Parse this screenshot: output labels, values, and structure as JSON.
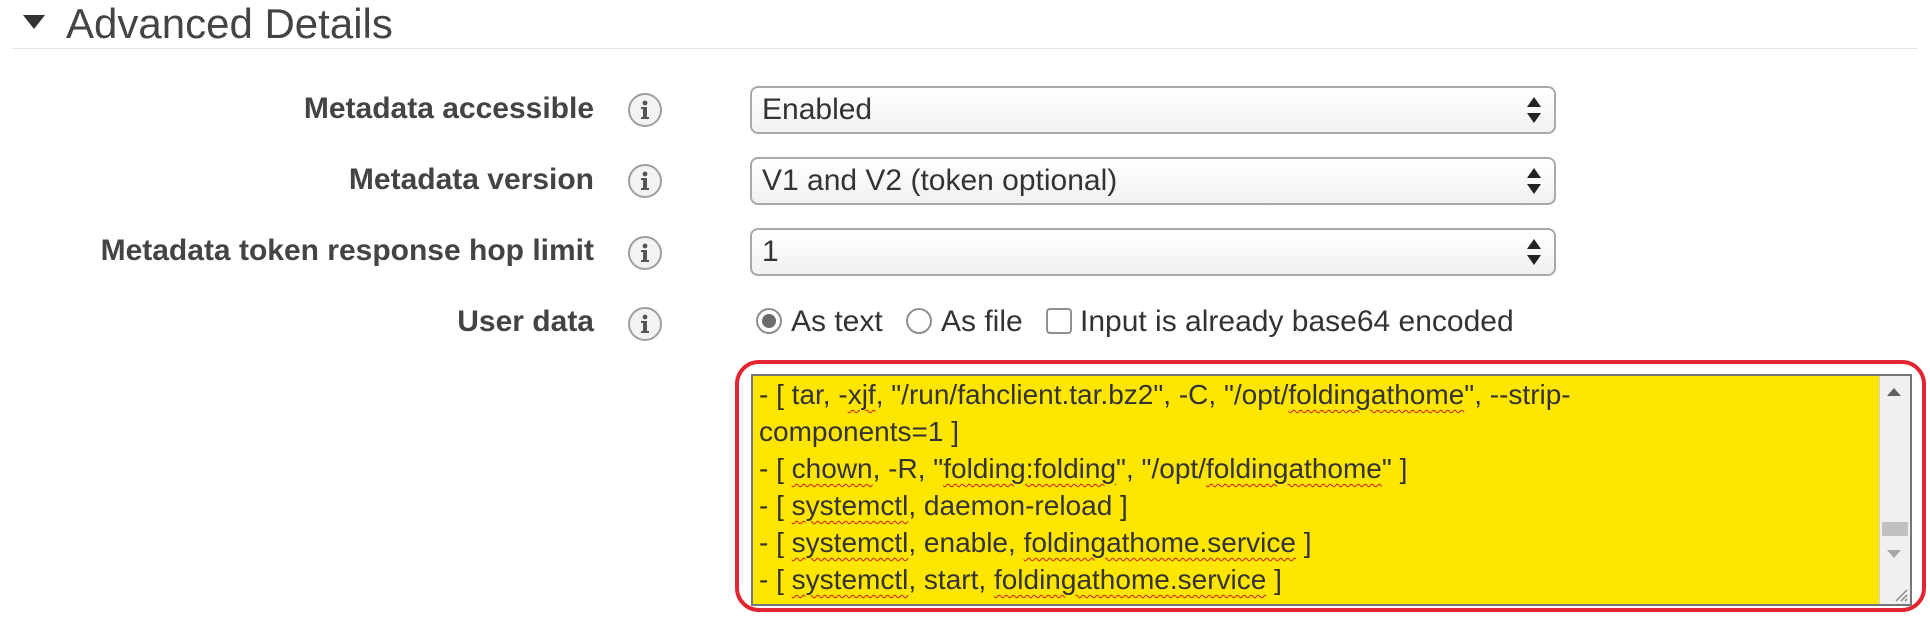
{
  "section": {
    "title": "Advanced Details",
    "expanded": true
  },
  "rows": {
    "metadata_accessible": {
      "label": "Metadata accessible",
      "value": "Enabled"
    },
    "metadata_version": {
      "label": "Metadata version",
      "value": "V1 and V2 (token optional)"
    },
    "hop_limit": {
      "label": "Metadata token response hop limit",
      "value": "1"
    },
    "user_data": {
      "label": "User data",
      "options": {
        "as_text": {
          "label": "As text",
          "checked": true
        },
        "as_file": {
          "label": "As file",
          "checked": false
        },
        "base64": {
          "label": "Input is already base64 encoded",
          "checked": false
        }
      },
      "text": {
        "l1": "- [ tar, -xjf, \"/run/fahclient.tar.bz2\", -C, \"/opt/foldingathome\", --strip-",
        "l2": "components=1 ]",
        "l3": "- [ chown, -R, \"folding:folding\", \"/opt/foldingathome\" ]",
        "l4": "- [ systemctl, daemon-reload ]",
        "l5": "- [ systemctl, enable, foldingathome.service ]",
        "l6": "- [ systemctl, start, foldingathome.service ]"
      }
    }
  },
  "icons": {
    "section_toggle": "caret-down-icon",
    "info": "info-icon",
    "select": "select-arrows-icon"
  },
  "colors": {
    "textarea_highlight": "#ffe600",
    "annotation_ring": "#e52431",
    "spellcheck_underline": "#d0192a"
  }
}
